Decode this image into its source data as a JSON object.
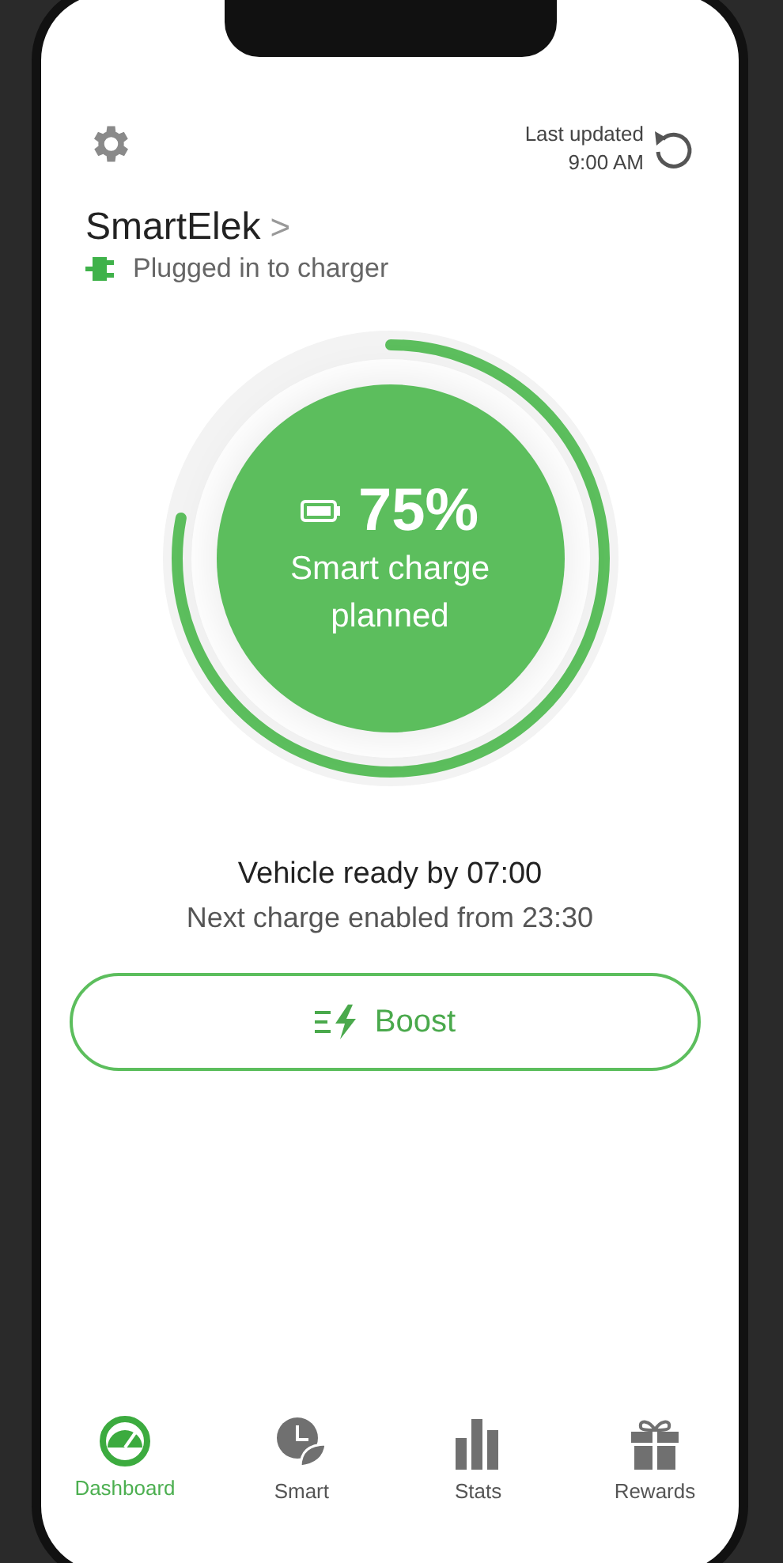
{
  "header": {
    "last_updated_label": "Last updated",
    "last_updated_time": "9:00 AM"
  },
  "vehicle": {
    "name": "SmartElek",
    "chevron": ">",
    "status": "Plugged in to charger"
  },
  "charge": {
    "percent": "75%",
    "status_line_1": "Smart charge",
    "status_line_2": "planned",
    "level": 0.78
  },
  "ready_text": "Vehicle ready by 07:00",
  "next_charge_text": "Next charge enabled from 23:30",
  "boost_button": {
    "label": "Boost"
  },
  "tabs": [
    {
      "label": "Dashboard",
      "kind": "gauge",
      "selected": true
    },
    {
      "label": "Smart",
      "kind": "clock-leaf",
      "selected": false
    },
    {
      "label": "Stats",
      "kind": "bars",
      "selected": false
    },
    {
      "label": "Rewards",
      "kind": "gift",
      "selected": false
    }
  ]
}
